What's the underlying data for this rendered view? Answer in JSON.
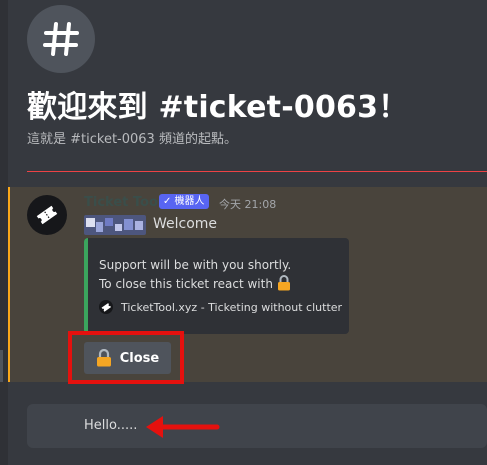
{
  "welcome": {
    "title": "歡迎來到 #ticket-0063！",
    "subtitle": "這就是 #ticket-0063 頻道的起點。",
    "channel_icon": "hash-icon"
  },
  "message": {
    "username": "Ticket Tool",
    "bot_badge": "✓ 機器人",
    "timestamp": "今天 21:08",
    "content": "Welcome",
    "embed": {
      "line1": "Support will be with you shortly.",
      "line2": "To close this ticket react with",
      "footer": "TicketTool.xyz - Ticketing without clutter",
      "accent_color": "#3ba55d"
    },
    "close_button": {
      "label": "Close",
      "icon": "lock-icon"
    }
  },
  "composer": {
    "text": "Hello....."
  },
  "colors": {
    "background": "#36393f",
    "highlight": "#e5110e",
    "mention_row": "#49443c",
    "blurple": "#5865f2"
  }
}
